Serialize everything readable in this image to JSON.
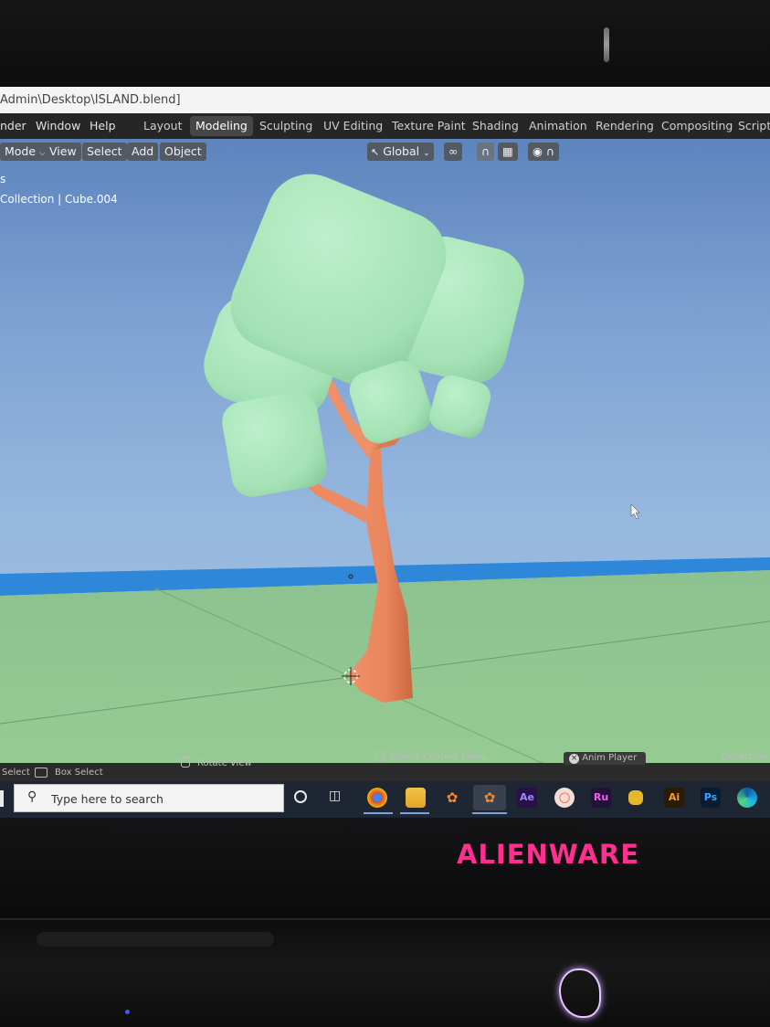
{
  "window": {
    "title": "Admin\\Desktop\\ISLAND.blend]"
  },
  "menu": [
    "nder",
    "Window",
    "Help"
  ],
  "workspaces": {
    "active": "Modeling",
    "tabs": [
      "Layout",
      "Modeling",
      "Sculpting",
      "UV Editing",
      "Texture Paint",
      "Shading",
      "Animation",
      "Rendering",
      "Compositing",
      "Scriptin"
    ]
  },
  "viewport_header": {
    "mode": "Mode",
    "view": "View",
    "select": "Select",
    "add": "Add",
    "object": "Object",
    "transform_orientation": "Global"
  },
  "viewport_info": {
    "line1": "s",
    "line2": "Collection | Cube.004"
  },
  "status_bar": {
    "select": "Select",
    "box_select": "Box Select",
    "rotate_view": "Rotate View",
    "context_menu": "Object Context Menu",
    "anim_player": "Anim Player",
    "collection": "Collection | C"
  },
  "taskbar": {
    "search_placeholder": "Type here to search",
    "apps": [
      {
        "name": "Ae",
        "color": "#2b0f49",
        "text_color": "#9a8cff"
      },
      {
        "name": "Ru",
        "color": "#231238",
        "text_color": "#f35bff"
      },
      {
        "name": "Ai",
        "color": "#2b1b05",
        "text_color": "#ff9b1e"
      },
      {
        "name": "Ps",
        "color": "#091c33",
        "text_color": "#33a8ff"
      }
    ]
  },
  "hardware": {
    "brand": "ALIENWARE"
  },
  "colors": {
    "accent_pink": "#ff2f8f",
    "foliage": "#a6e3b8",
    "trunk": "#e98961",
    "ground": "#8fc68f",
    "water": "#2f87d9",
    "sky": "#8fb2dd"
  }
}
